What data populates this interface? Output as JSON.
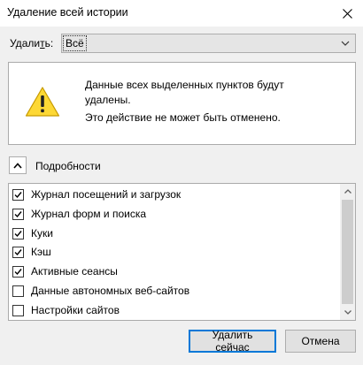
{
  "dialog": {
    "title": "Удаление всей истории"
  },
  "time_range": {
    "label_prefix": "Удали",
    "label_underlined": "т",
    "label_suffix": "ь:",
    "selected": "Всё"
  },
  "warning": {
    "line1": "Данные всех выделенных пунктов будут удалены.",
    "line2": "Это действие не может быть отменено."
  },
  "details": {
    "label": "Подробности",
    "items": [
      {
        "label": "Журнал посещений и загрузок",
        "checked": true
      },
      {
        "label": "Журнал форм и поиска",
        "checked": true
      },
      {
        "label": "Куки",
        "checked": true
      },
      {
        "label": "Кэш",
        "checked": true
      },
      {
        "label": "Активные сеансы",
        "checked": true
      },
      {
        "label": "Данные автономных веб-сайтов",
        "checked": false
      },
      {
        "label": "Настройки сайтов",
        "checked": false
      }
    ]
  },
  "buttons": {
    "clear_now": "Удалить сейчас",
    "cancel": "Отмена"
  },
  "colors": {
    "accent": "#0078d7",
    "warning_yellow": "#fdd835"
  }
}
